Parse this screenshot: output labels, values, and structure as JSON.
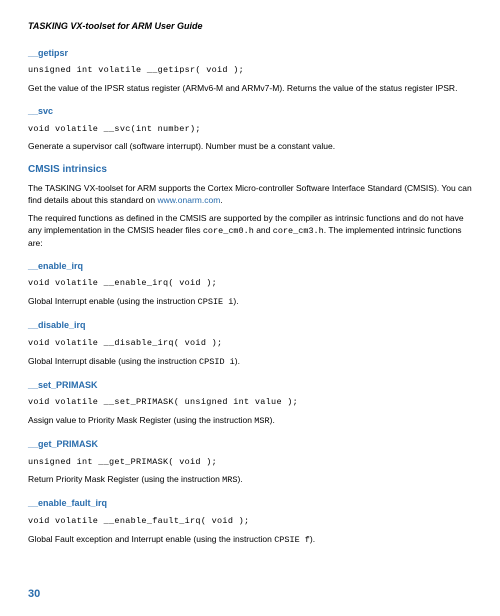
{
  "header": {
    "title": "TASKING VX-toolset for ARM User Guide"
  },
  "sections": [
    {
      "heading": "__getipsr",
      "code": "unsigned int volatile __getipsr( void );",
      "para": "Get the value of the IPSR status register (ARMv6-M and ARMv7-M). Returns the value of the status register IPSR."
    },
    {
      "heading": "__svc",
      "code": "void volatile __svc(int number);",
      "para": "Generate a supervisor call (software interrupt). Number must be a constant value."
    }
  ],
  "cmsis": {
    "heading": "CMSIS intrinsics",
    "para1_pre": "The TASKING VX-toolset for ARM supports the Cortex Micro-controller Software Interface Standard (CMSIS). You can find details about this standard on ",
    "link": "www.onarm.com",
    "para1_post": ".",
    "para2_pre": "The required functions as defined in the CMSIS are supported by the compiler as intrinsic functions and do not have any implementation in the CMSIS header files ",
    "code1": "core_cm0.h",
    "mid": " and ",
    "code2": "core_cm3.h",
    "para2_post": ". The implemented intrinsic functions are:"
  },
  "intrinsics": [
    {
      "heading": "__enable_irq",
      "code": "void volatile __enable_irq( void );",
      "para_pre": "Global Interrupt enable (using the instruction ",
      "para_code": "CPSIE i",
      "para_post": ")."
    },
    {
      "heading": "__disable_irq",
      "code": "void volatile __disable_irq( void );",
      "para_pre": "Global Interrupt disable (using the instruction ",
      "para_code": "CPSID i",
      "para_post": ")."
    },
    {
      "heading": "__set_PRIMASK",
      "code": "void volatile __set_PRIMASK( unsigned int value );",
      "para_pre": "Assign value to Priority Mask Register (using the instruction ",
      "para_code": "MSR",
      "para_post": ")."
    },
    {
      "heading": "__get_PRIMASK",
      "code": "unsigned int __get_PRIMASK( void );",
      "para_pre": "Return Priority Mask Register (using the instruction ",
      "para_code": "MRS",
      "para_post": ")."
    },
    {
      "heading": "__enable_fault_irq",
      "code": "void volatile __enable_fault_irq( void );",
      "para_pre": "Global Fault exception and Interrupt enable (using the instruction ",
      "para_code": "CPSIE f",
      "para_post": ")."
    }
  ],
  "page_number": "30"
}
